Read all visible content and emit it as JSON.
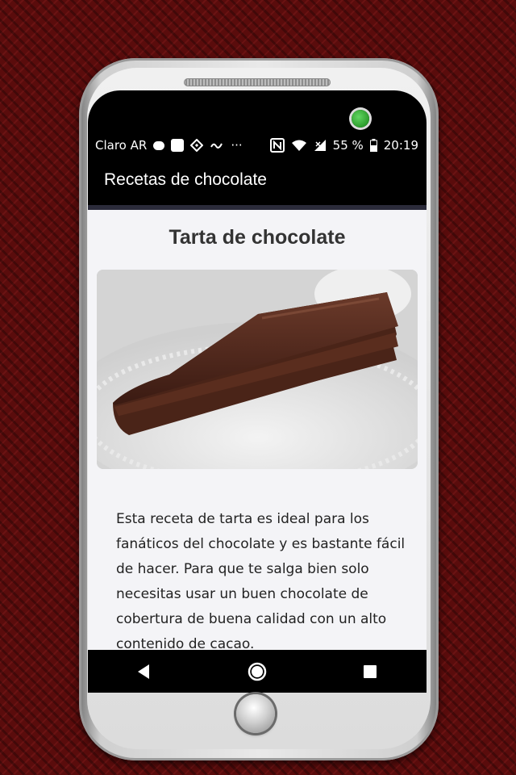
{
  "status_bar": {
    "carrier": "Claro AR",
    "ellipsis": "···",
    "battery_percent": "55 %",
    "time": "20:19",
    "icons": [
      "chat-bubble-icon",
      "notification-square-icon",
      "binance-icon",
      "swipe-icon",
      "nfc-icon",
      "wifi-icon",
      "signal-icon",
      "battery-icon"
    ]
  },
  "app_bar": {
    "title": "Recetas de chocolate"
  },
  "recipe": {
    "title": "Tarta de chocolate",
    "image_alt": "chocolate-cake-slice-photo",
    "description": "Esta receta de tarta es ideal para los fanáticos del chocolate y es bastante fácil de hacer. Para que te salga bien solo necesitas usar un buen chocolate de cobertura de buena calidad con un alto contenido de cacao."
  },
  "nav_bar": {
    "buttons": [
      "back-icon",
      "home-icon",
      "recents-icon"
    ]
  },
  "colors": {
    "background": "#5a0c0c",
    "app_bar": "#000000",
    "content_bg": "#f4f4f7",
    "camera_led": "#3cb83c"
  }
}
